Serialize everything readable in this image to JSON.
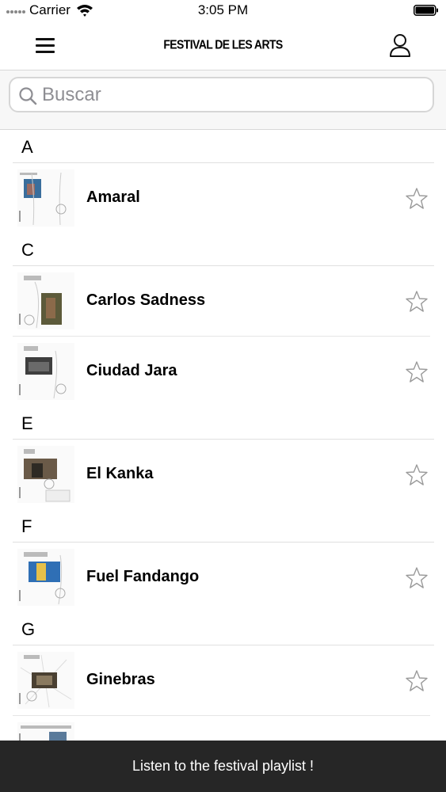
{
  "status_bar": {
    "carrier": "Carrier",
    "time": "3:05 PM"
  },
  "nav": {
    "title": "FESTIVAL DE LES ARTS",
    "menu_icon": "hamburger-menu-icon",
    "user_icon": "user-profile-icon"
  },
  "search": {
    "placeholder": "Buscar",
    "value": ""
  },
  "sections": [
    {
      "letter": "A",
      "artists": [
        {
          "name": "Amaral",
          "accent": "#3a6e9c"
        }
      ]
    },
    {
      "letter": "C",
      "artists": [
        {
          "name": "Carlos Sadness",
          "accent": "#5c5a3a"
        },
        {
          "name": "Ciudad Jara",
          "accent": "#3e3e3e"
        }
      ]
    },
    {
      "letter": "E",
      "artists": [
        {
          "name": "El Kanka",
          "accent": "#6a5a48"
        }
      ]
    },
    {
      "letter": "F",
      "artists": [
        {
          "name": "Fuel Fandango",
          "accent": "#2f6fb5"
        }
      ]
    },
    {
      "letter": "G",
      "artists": [
        {
          "name": "Ginebras",
          "accent": "#4a4032"
        }
      ]
    }
  ],
  "banner": {
    "text": "Listen to the festival playlist !"
  },
  "colors": {
    "banner_bg": "#262626",
    "star": "#9a9a9a"
  }
}
